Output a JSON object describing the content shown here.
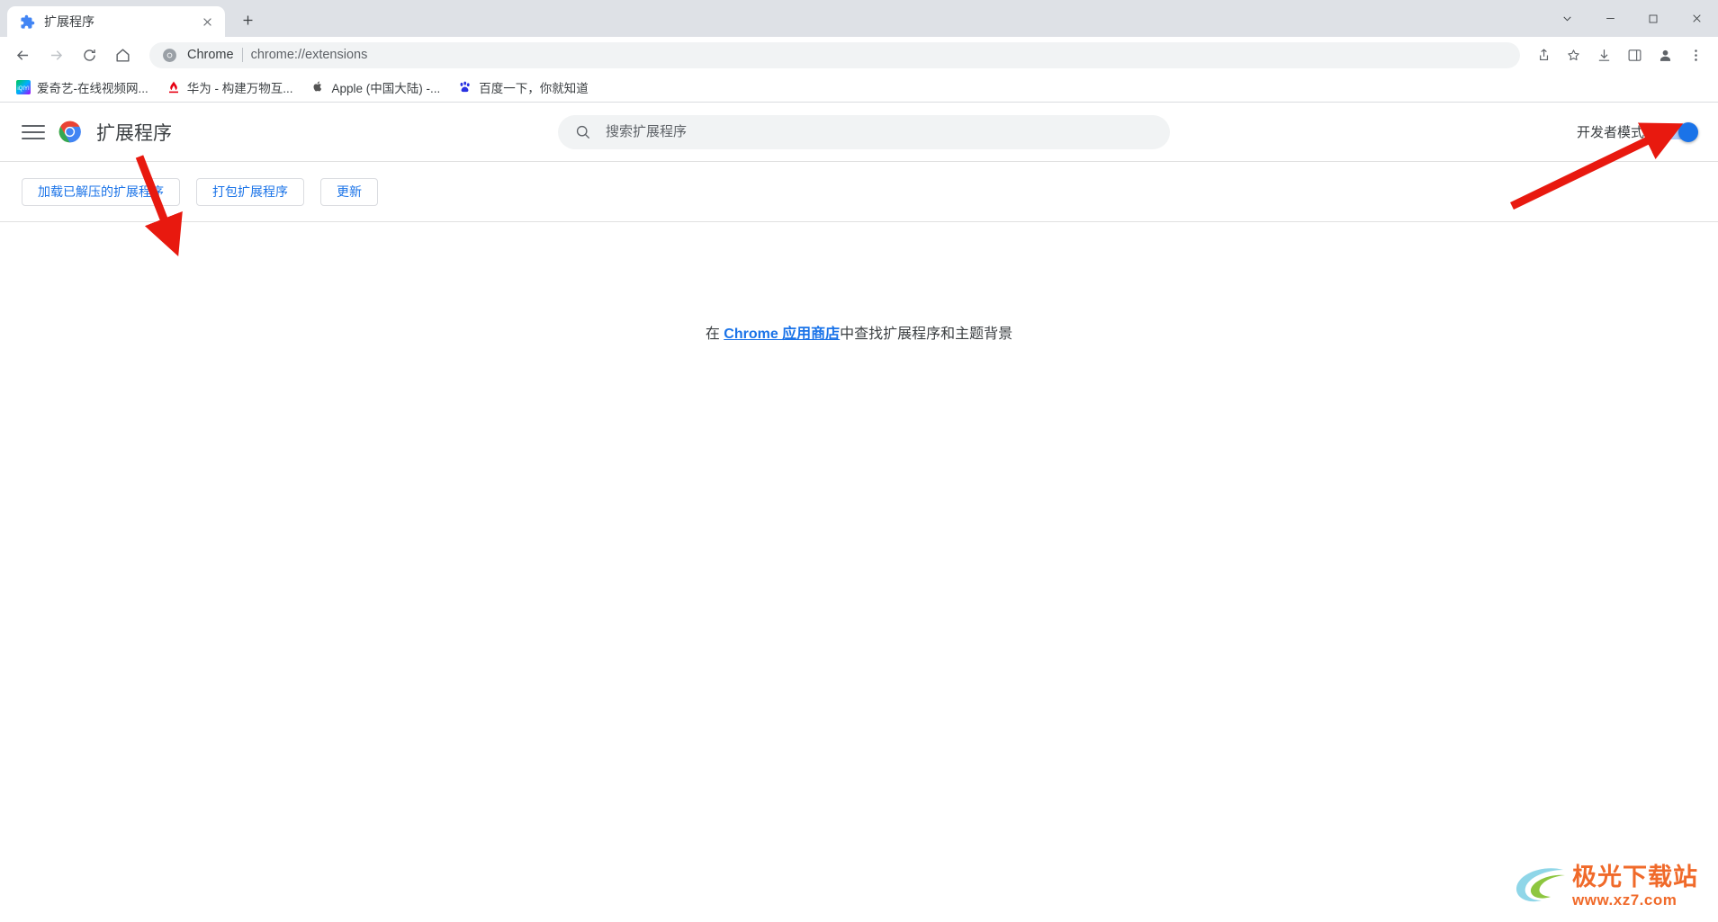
{
  "window": {
    "controls": [
      "chevron-down",
      "minimize",
      "maximize",
      "close"
    ]
  },
  "tabstrip": {
    "tabs": [
      {
        "title": "扩展程序",
        "favicon": "puzzle-icon",
        "active": true
      }
    ],
    "new_tab_label": "+"
  },
  "toolbar": {
    "back_label": "←",
    "forward_label": "→",
    "reload_label": "⟳",
    "home_label": "⌂",
    "omnibox": {
      "chip": "Chrome",
      "url": "chrome://extensions",
      "icon": "chrome-logo-icon"
    },
    "right_icons": [
      "share-icon",
      "bookmark-star-icon",
      "download-icon",
      "side-panel-icon",
      "profile-icon",
      "more-menu-icon"
    ]
  },
  "bookmarks": [
    {
      "label": "爱奇艺-在线视频网...",
      "icon": "iqiyi-icon"
    },
    {
      "label": "华为 - 构建万物互...",
      "icon": "huawei-icon"
    },
    {
      "label": "Apple (中国大陆) -...",
      "icon": "apple-icon"
    },
    {
      "label": "百度一下，你就知道",
      "icon": "baidu-icon"
    }
  ],
  "extensions_page": {
    "title": "扩展程序",
    "menu_icon": "hamburger-menu-icon",
    "logo_icon": "chrome-logo-icon",
    "search": {
      "placeholder": "搜索扩展程序",
      "value": "",
      "icon": "search-icon"
    },
    "developer_mode": {
      "label": "开发者模式",
      "enabled": true
    },
    "actions": [
      {
        "label": "加载已解压的扩展程序",
        "name": "load-unpacked-button"
      },
      {
        "label": "打包扩展程序",
        "name": "pack-extension-button"
      },
      {
        "label": "更新",
        "name": "update-button"
      }
    ],
    "empty_state": {
      "prefix": "在 ",
      "link": "Chrome 应用商店",
      "suffix": "中查找扩展程序和主题背景"
    }
  },
  "annotations": {
    "arrow_color": "#e8190f",
    "arrows": [
      {
        "name": "arrow-to-load-unpacked",
        "points_to": "加载已解压的扩展程序"
      },
      {
        "name": "arrow-to-developer-mode-toggle",
        "points_to": "开发者模式"
      }
    ]
  },
  "watermark": {
    "title": "极光下载站",
    "url": "www.xz7.com"
  },
  "colors": {
    "accent": "#1a73e8",
    "tabstrip_bg": "#dee1e6",
    "omnibox_bg": "#f1f3f4",
    "toggle_on": "#1a73e8",
    "annotation_red": "#e8190f"
  }
}
